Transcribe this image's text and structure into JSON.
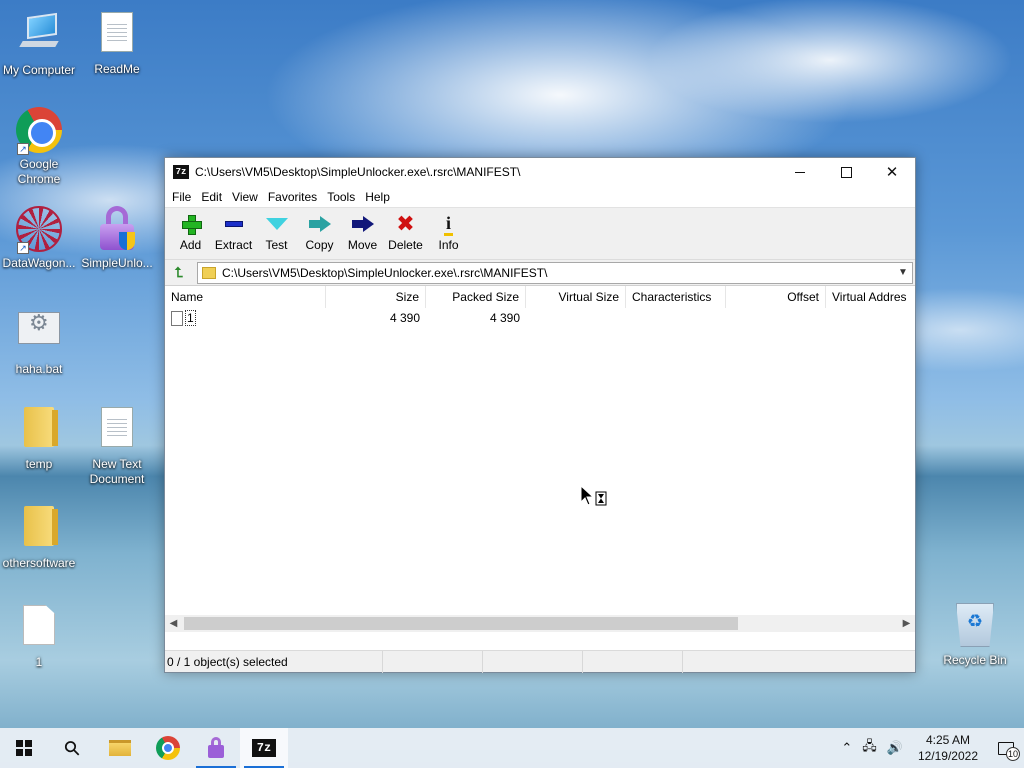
{
  "desktop": {
    "icons": [
      {
        "label": "My Computer"
      },
      {
        "label": "ReadMe"
      },
      {
        "label": "Google Chrome"
      },
      {
        "label": "DataWagon..."
      },
      {
        "label": "SimpleUnlo..."
      },
      {
        "label": "haha.bat"
      },
      {
        "label": "temp"
      },
      {
        "label": "New Text Document"
      },
      {
        "label": "othersoftware"
      },
      {
        "label": "1"
      },
      {
        "label": "Recycle Bin"
      }
    ]
  },
  "window": {
    "app_icon_text": "7z",
    "title": "C:\\Users\\VM5\\Desktop\\SimpleUnlocker.exe\\.rsrc\\MANIFEST\\",
    "close_glyph": "✕",
    "menu": [
      "File",
      "Edit",
      "View",
      "Favorites",
      "Tools",
      "Help"
    ],
    "toolbar": [
      {
        "label": "Add",
        "icon": "add-icon"
      },
      {
        "label": "Extract",
        "icon": "extract-icon"
      },
      {
        "label": "Test",
        "icon": "test-icon"
      },
      {
        "label": "Copy",
        "icon": "copy-icon"
      },
      {
        "label": "Move",
        "icon": "move-icon"
      },
      {
        "label": "Delete",
        "icon": "delete-icon"
      },
      {
        "label": "Info",
        "icon": "info-icon"
      }
    ],
    "delete_glyph": "✖",
    "info_glyph": "i",
    "up_glyph": "⮤",
    "address": {
      "path": "C:\\Users\\VM5\\Desktop\\SimpleUnlocker.exe\\.rsrc\\MANIFEST\\",
      "dropdown_glyph": "▼"
    },
    "columns": [
      "Name",
      "Size",
      "Packed Size",
      "Virtual Size",
      "Characteristics",
      "Offset",
      "Virtual Addres"
    ],
    "rows": [
      {
        "name": "1",
        "size": "4 390",
        "packed_size": "4 390",
        "virtual_size": "",
        "characteristics": "",
        "offset": "",
        "virtual_address": ""
      }
    ],
    "scroll_left": "◀",
    "scroll_right": "▶",
    "status": {
      "selected": "0 / 1 object(s) selected",
      "seg2": "",
      "seg3": "",
      "seg4": ""
    }
  },
  "taskbar": {
    "search_glyph": "⚲",
    "tray": {
      "chevron": "⌃",
      "network": "🖧",
      "volume": "🔊",
      "time": "4:25 AM",
      "date": "12/19/2022",
      "notifications": "10"
    },
    "app_7z_text": "7z"
  }
}
